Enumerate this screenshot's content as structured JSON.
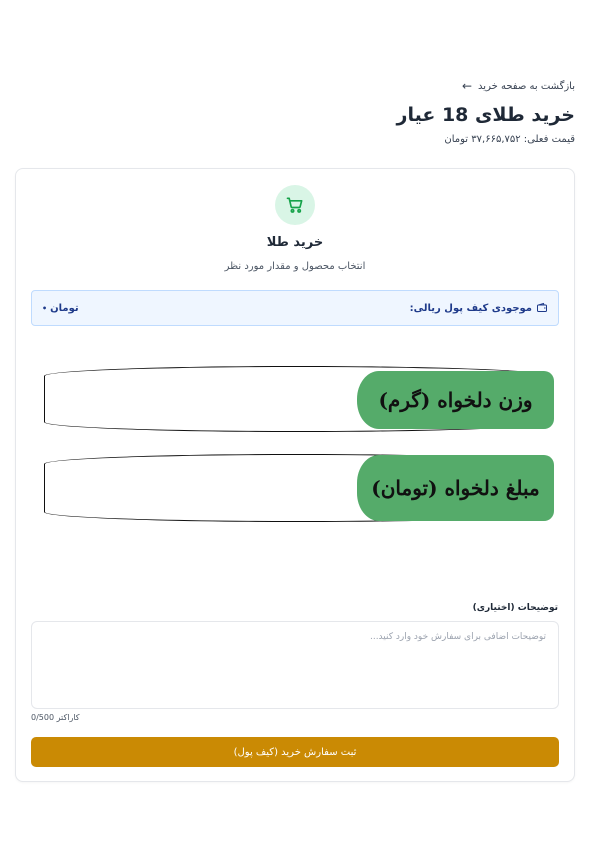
{
  "header": {
    "back_label": "بازگشت به صفحه خرید",
    "title": "خرید طلای 18 عیار",
    "price_label": "قیمت فعلی:",
    "price_value": "۳۷,۶۶۵,۷۵۲",
    "price_unit": "تومان"
  },
  "card": {
    "title": "خرید طلا",
    "subtitle": "انتخاب محصول و مقدار مورد نظر",
    "wallet_label": "موجودی کیف پول ریالی:",
    "wallet_value": "تومان",
    "weight_label": "وزن دلخواه (گرم)",
    "amount_label": "مبلغ دلخواه (تومان)",
    "notes_label": "توضیحات (اختیاری)",
    "notes_placeholder": "توضیحات اضافی برای سفارش خود وارد کنید...",
    "char_count": "0/500 کاراکتر",
    "submit_label": "ثبت سفارش خرید (کیف پول)"
  },
  "colors": {
    "accent_gold": "#ca8a04",
    "green_label": "#55ab6a",
    "cart_bg": "#d9f5e6",
    "cart_icon": "#16a34a",
    "wallet_bg": "#eff6ff"
  },
  "icons": {
    "back": "arrow-left-icon",
    "cart": "shopping-cart-icon",
    "wallet": "wallet-icon"
  }
}
